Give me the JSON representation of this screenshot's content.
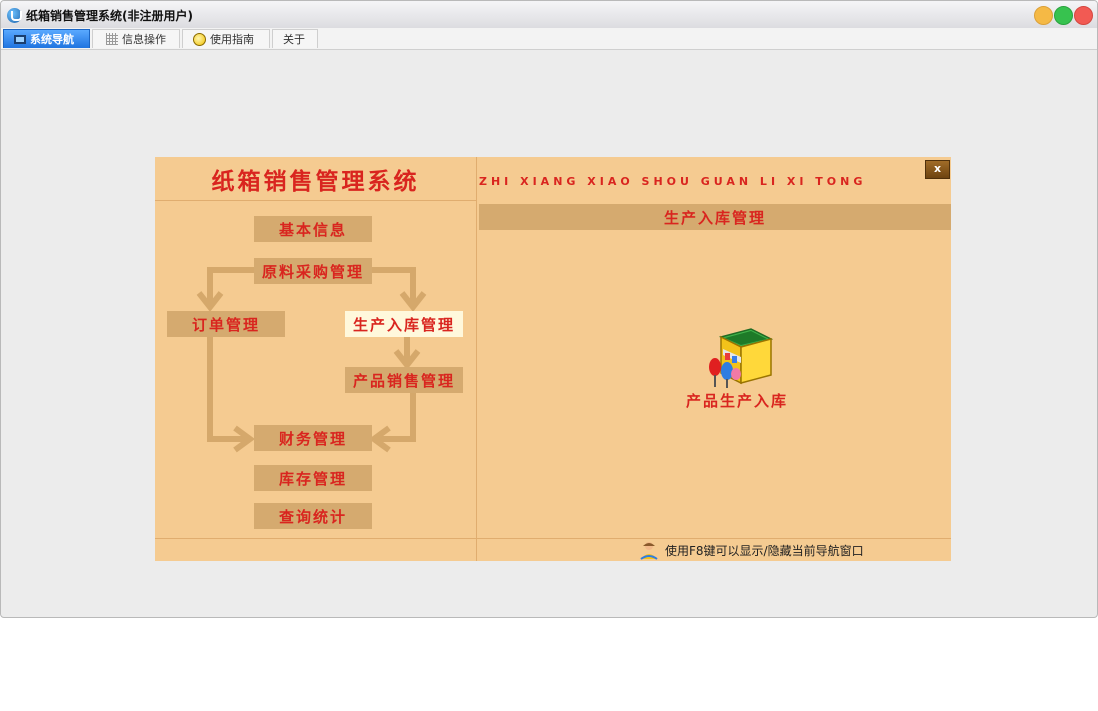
{
  "window": {
    "title": "纸箱销售管理系统(非注册用户)"
  },
  "tabs": [
    {
      "label": "系统导航",
      "icon": "monitor-icon",
      "active": true
    },
    {
      "label": "信息操作",
      "icon": "grid-icon",
      "active": false
    },
    {
      "label": "使用指南",
      "icon": "bulb-icon",
      "active": false
    },
    {
      "label": "关于",
      "icon": "",
      "active": false
    }
  ],
  "nav": {
    "system_title": "纸箱销售管理系统",
    "pinyin_title": "ZHI XIANG XIAO SHOU GUAN LI XI TONG",
    "close_label": "x",
    "flow": {
      "basic_info": "基本信息",
      "purchase": "原料采购管理",
      "orders": "订单管理",
      "production": "生产入库管理",
      "sales": "产品销售管理",
      "finance": "财务管理",
      "inventory": "库存管理",
      "query": "查询统计"
    },
    "selected": "production",
    "detail": {
      "header": "生产入库管理",
      "item_label": "产品生产入库",
      "item_icon": "store-icon"
    },
    "hint": "使用F8键可以显示/隐藏当前导航窗口"
  },
  "colors": {
    "panel_bg": "#f5cb91",
    "node_bg": "#d5aa6f",
    "node_text": "#d9251f",
    "selected_bg": "#fff8dc"
  }
}
